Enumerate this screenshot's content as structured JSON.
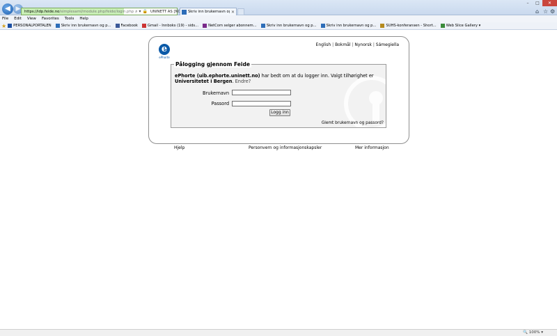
{
  "browser": {
    "url_domain": "https://idp.feide.no",
    "url_rest": "/simplesaml/module.php/feide/login.php",
    "cert_label": "UNINETT AS [NO]",
    "tab_title": "Skriv inn brukernavn og pas...",
    "menu": [
      "File",
      "Edit",
      "View",
      "Favorites",
      "Tools",
      "Help"
    ],
    "favorites": [
      {
        "label": "PERSONALPORTALEN",
        "color": "#1b4fa3"
      },
      {
        "label": "Skriv inn brukernavn og p...",
        "color": "#2d6db8"
      },
      {
        "label": "Facebook",
        "color": "#3b5998"
      },
      {
        "label": "Gmail - Innboks (19) - sids...",
        "color": "#c33"
      },
      {
        "label": "NetCom selger abonnem...",
        "color": "#7a2a8a"
      },
      {
        "label": "Skriv inn brukernavn og p...",
        "color": "#2d6db8"
      },
      {
        "label": "Skriv inn brukernavn og p...",
        "color": "#2d6db8"
      },
      {
        "label": "SUHS-konferansen - Short...",
        "color": "#b58a1e"
      },
      {
        "label": "Web Slice Gallery ▾",
        "color": "#3a8b3a"
      }
    ],
    "zoom": "100%"
  },
  "page": {
    "logo_letter": "e",
    "logo_text": "ePhorte",
    "languages": {
      "english": "English",
      "bokmal": "Bokmål",
      "nynorsk": "Nynorsk",
      "sami": "Sámegiella"
    },
    "legend": "Pålogging gjennom Feide",
    "intro_service": "ePhorte (uib.ephorte.uninett.no)",
    "intro_text": " har bedt om at du logger inn. Valgt tilhørighet er ",
    "intro_org": "Universitetet i Bergen",
    "intro_change": "Endre?",
    "username_label": "Brukernavn",
    "password_label": "Passord",
    "login_button": "Logg inn",
    "forgot_link": "Glemt brukernavn og passord?",
    "footer": {
      "help": "Hjelp",
      "privacy": "Personvern og informasjonskapsler",
      "more": "Mer informasjon"
    }
  }
}
